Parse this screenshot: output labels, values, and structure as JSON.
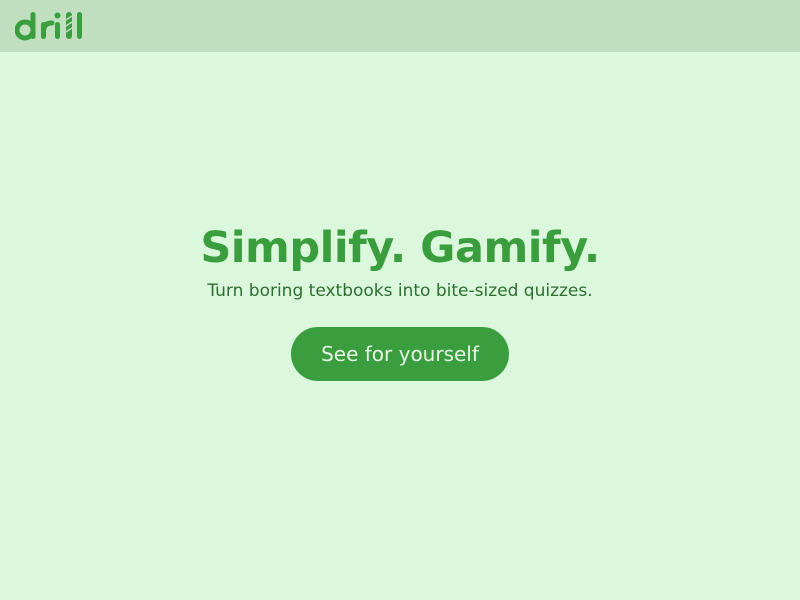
{
  "brand": {
    "logo_text": "drill",
    "accent_color": "#3a9e3e",
    "header_color": "#bfdfbf",
    "background_color": "#dbf7dc"
  },
  "hero": {
    "headline": "Simplify. Gamify.",
    "subheadline": "Turn boring textbooks into bite-sized quizzes.",
    "cta_label": "See for yourself"
  }
}
